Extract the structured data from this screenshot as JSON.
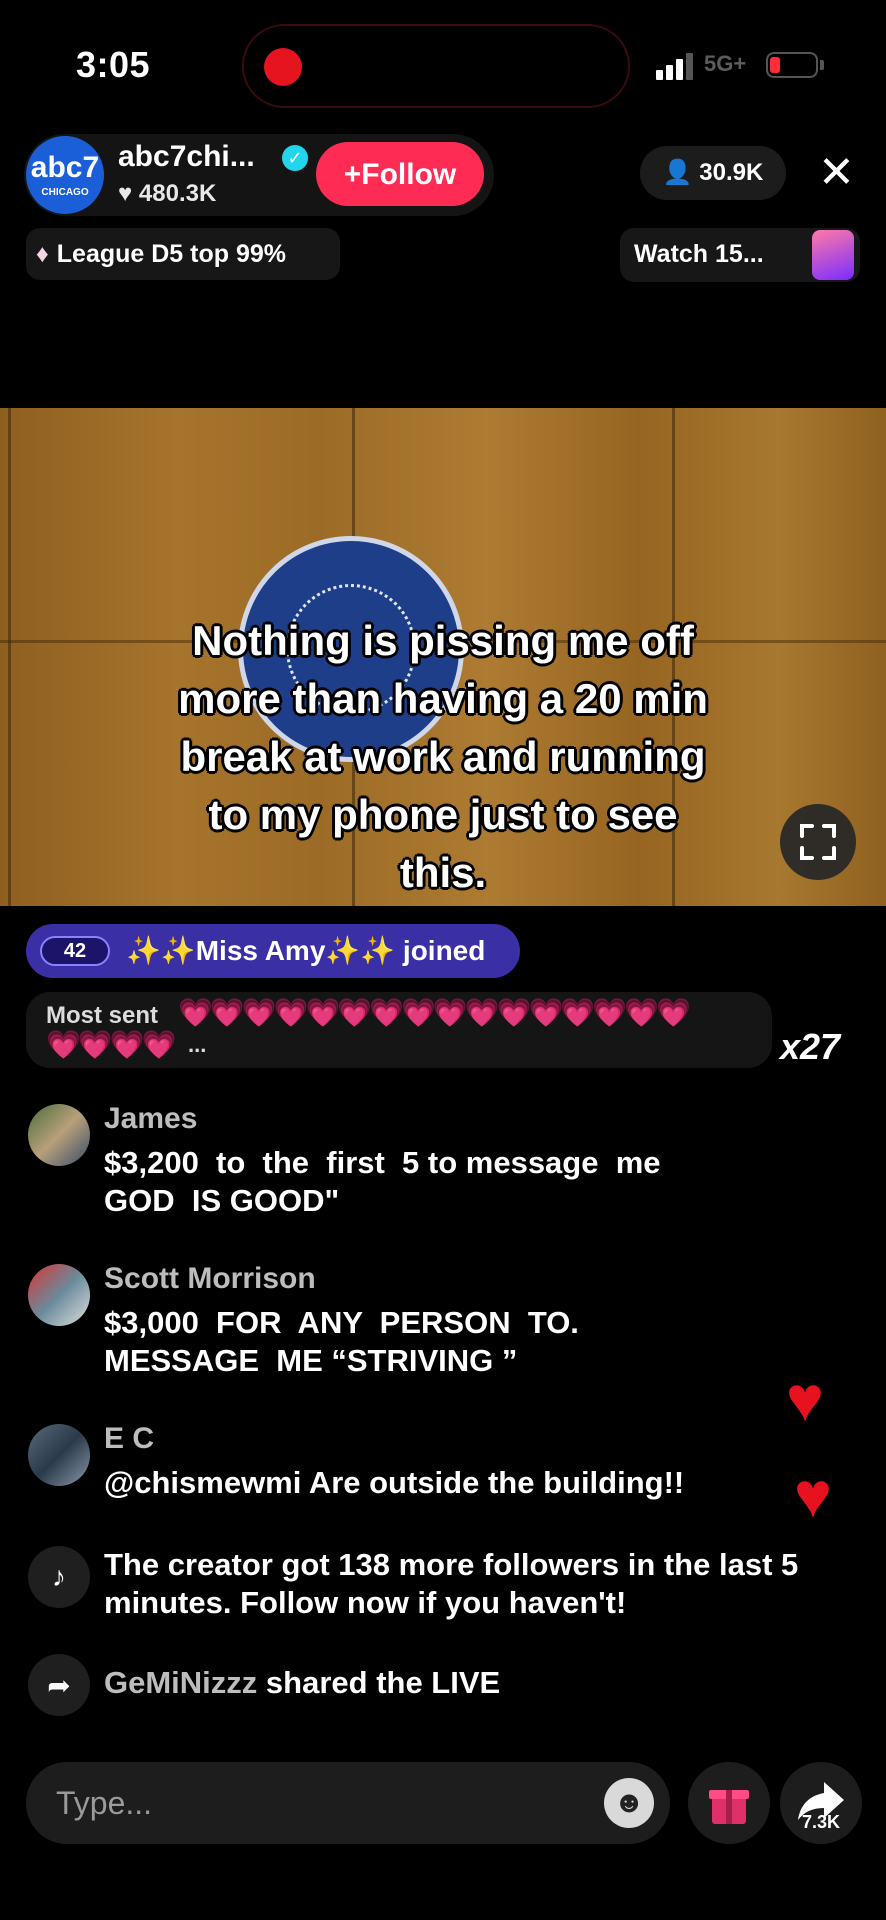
{
  "status_bar": {
    "time": "3:05",
    "network": "5G+"
  },
  "host": {
    "name": "abc7chi...",
    "likes": "480.3K",
    "avatar_logo": "abc7",
    "avatar_city": "CHICAGO",
    "follow_label": "Follow"
  },
  "viewers": "30.9K",
  "league": "League D5 top 99%",
  "watch_label": "Watch 15...",
  "video": {
    "caption_lines": [
      "Nothing is pissing me off",
      "more than having a 20 min",
      "break at work and running",
      "to my phone just to see",
      "this."
    ]
  },
  "joined": {
    "level": "42",
    "text": "✨✨Miss Amy✨✨ joined"
  },
  "most_sent": {
    "label": "Most sent",
    "hearts_row1": "💗💗💗💗💗💗💗💗💗💗💗💗💗💗💗💗",
    "hearts_row2": "💗💗💗💗",
    "ellipsis": "...",
    "combo": "x27"
  },
  "comments": [
    {
      "name": "James",
      "text": "$3,200  to  the  first  5 to message  me\nGOD  IS GOOD\""
    },
    {
      "name": "Scott Morrison",
      "text": "$3,000  FOR  ANY  PERSON  TO.\nMESSAGE  ME “STRIVING ”"
    },
    {
      "name": "E C",
      "text": "@chismewmi Are outside the building!!"
    }
  ],
  "system_message": "The creator got 138 more followers in the last 5 minutes. Follow now if you haven't!",
  "share_event": {
    "user": "GeMiNizzz",
    "action": "shared the LIVE"
  },
  "input": {
    "placeholder": "Type..."
  },
  "share_count": "7.3K"
}
